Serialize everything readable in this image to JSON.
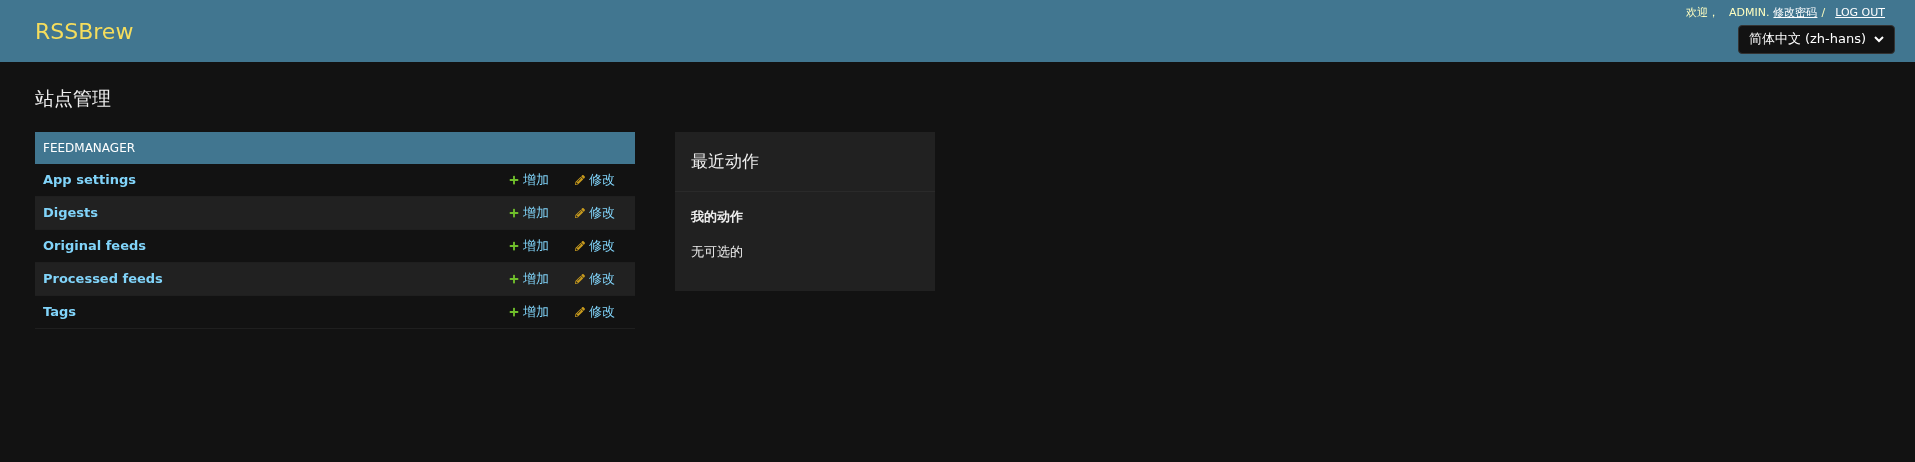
{
  "header": {
    "brand": "RSSBrew",
    "welcome": "欢迎，",
    "user": "ADMIN",
    "user_suffix": ".",
    "change_password": "修改密码",
    "separator": "/",
    "logout": "LOG OUT",
    "language": "简体中文 (zh-hans)"
  },
  "title": "站点管理",
  "app": {
    "name": "FEEDMANAGER",
    "models": [
      {
        "name": "App settings",
        "add": "增加",
        "change": "修改"
      },
      {
        "name": "Digests",
        "add": "增加",
        "change": "修改"
      },
      {
        "name": "Original feeds",
        "add": "增加",
        "change": "修改"
      },
      {
        "name": "Processed feeds",
        "add": "增加",
        "change": "修改"
      },
      {
        "name": "Tags",
        "add": "增加",
        "change": "修改"
      }
    ]
  },
  "recent_actions": {
    "title": "最近动作",
    "subtitle": "我的动作",
    "empty": "无可选的"
  }
}
